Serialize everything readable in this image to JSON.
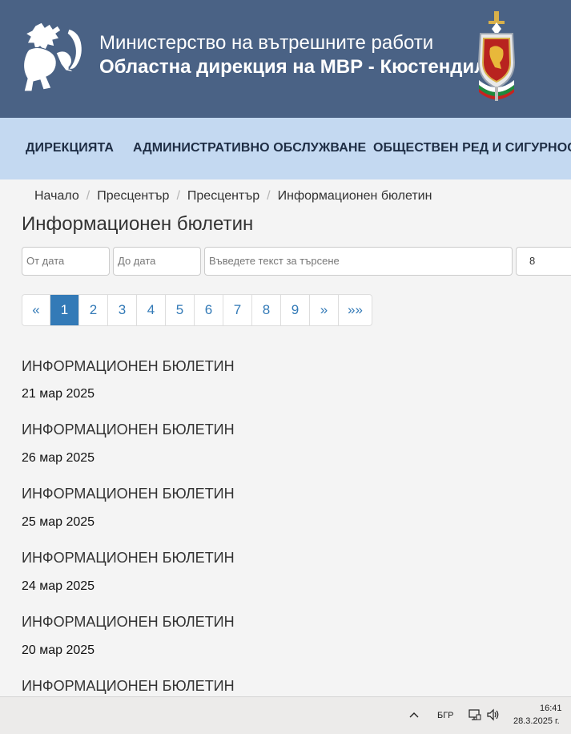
{
  "header": {
    "title_line1": "Министерство на вътрешните работи",
    "title_line2": "Областна дирекция на МВР - Кюстендил",
    "bg_color": "#4a6285"
  },
  "nav": {
    "items": [
      {
        "label": "ДИРЕКЦИЯТА"
      },
      {
        "label": "АДМИНИСТРАТИВНО ОБСЛУЖВАНЕ"
      },
      {
        "label": "ОБЩЕСТВЕН РЕД И СИГУРНОСТ"
      }
    ],
    "bg_color": "#c4d9f1"
  },
  "breadcrumb": {
    "items": [
      "Начало",
      "Пресцентър",
      "Пресцентър",
      "Информационен бюлетин"
    ],
    "separator": "/"
  },
  "page_title": "Информационен бюлетин",
  "filters": {
    "from_date_placeholder": "От дата",
    "to_date_placeholder": "До дата",
    "search_placeholder": "Въведете текст за търсене",
    "page_size_value": "8"
  },
  "pagination": {
    "first": "«",
    "pages": [
      "1",
      "2",
      "3",
      "4",
      "5",
      "6",
      "7",
      "8",
      "9"
    ],
    "active_page": "1",
    "next": "»",
    "last": "»»",
    "accent_color": "#337ab7"
  },
  "bulletins": [
    {
      "title": "ИНФОРМАЦИОНЕН БЮЛЕТИН",
      "date": "21 мар 2025"
    },
    {
      "title": "ИНФОРМАЦИОНЕН БЮЛЕТИН",
      "date": "26 мар 2025"
    },
    {
      "title": "ИНФОРМАЦИОНЕН БЮЛЕТИН",
      "date": "25 мар 2025"
    },
    {
      "title": "ИНФОРМАЦИОНЕН БЮЛЕТИН",
      "date": "24 мар 2025"
    },
    {
      "title": "ИНФОРМАЦИОНЕН БЮЛЕТИН",
      "date": "20 мар 2025"
    },
    {
      "title": "ИНФОРМАЦИОНЕН БЮЛЕТИН",
      "date": ""
    }
  ],
  "taskbar": {
    "language": "БГР",
    "time": "16:41",
    "date": "28.3.2025 г.",
    "icons": [
      "chevron-up-icon",
      "network-icon",
      "speaker-icon"
    ]
  }
}
